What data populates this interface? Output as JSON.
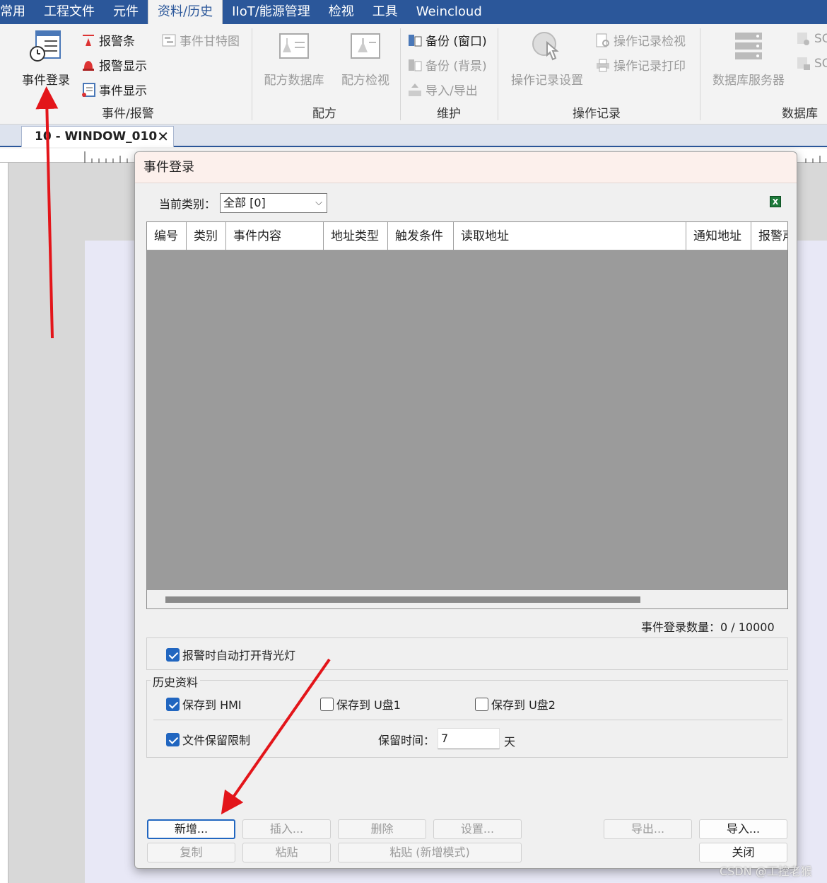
{
  "menu": {
    "items": [
      "常用",
      "工程文件",
      "元件",
      "资料/历史",
      "IIoT/能源管理",
      "检视",
      "工具",
      "Weincloud"
    ],
    "active_index": 3
  },
  "ribbon": {
    "event_login": "事件登录",
    "alarm_bar": "报警条",
    "alarm_display": "报警显示",
    "event_display": "事件显示",
    "event_gantt": "事件甘特图",
    "group_event": "事件/报警",
    "recipe_db": "配方数据库",
    "recipe_view": "配方检视",
    "group_recipe": "配方",
    "backup_window": "备份 (窗口)",
    "backup_bg": "备份 (背景)",
    "import_export": "导入/导出",
    "group_maintain": "维护",
    "oplog_settings": "操作记录设置",
    "oplog_view": "操作记录检视",
    "oplog_print": "操作记录打印",
    "group_oplog": "操作记录",
    "db_server": "数据库服务器",
    "sql1": "SQ",
    "sql2": "SQ",
    "group_db": "数据库"
  },
  "doc_tab": {
    "title": "10 - WINDOW_010",
    "close": "✕"
  },
  "dialog": {
    "title": "事件登录",
    "category_label": "当前类别：",
    "category_value": "全部 [0]",
    "excel_icon": "X",
    "columns": [
      "编号",
      "类别",
      "事件内容",
      "地址类型",
      "触发条件",
      "读取地址",
      "通知地址",
      "报警声"
    ],
    "count_text": "事件登录数量：0 / 10000",
    "auto_backlight": {
      "label": "报警时自动打开背光灯",
      "checked": true
    },
    "history_legend": "历史资料",
    "save_hmi": {
      "label": "保存到 HMI",
      "checked": true
    },
    "save_usb1": {
      "label": "保存到 U盘1",
      "checked": false
    },
    "save_usb2": {
      "label": "保存到 U盘2",
      "checked": false
    },
    "file_limit": {
      "label": "文件保留限制",
      "checked": true
    },
    "keep_label": "保留时间：",
    "keep_value": "7",
    "keep_unit": "天",
    "buttons": {
      "add": "新增...",
      "insert": "插入...",
      "delete": "删除",
      "settings": "设置...",
      "export": "导出...",
      "import": "导入...",
      "copy": "复制",
      "paste": "粘贴",
      "paste_new": "粘贴 (新增模式)",
      "close": "关闭"
    }
  },
  "watermark": "CSDN @工控老猴",
  "colors": {
    "menubar": "#2b579a",
    "arrow": "#e3151a",
    "check": "#2166c0",
    "table_body": "#9b9b9b"
  }
}
